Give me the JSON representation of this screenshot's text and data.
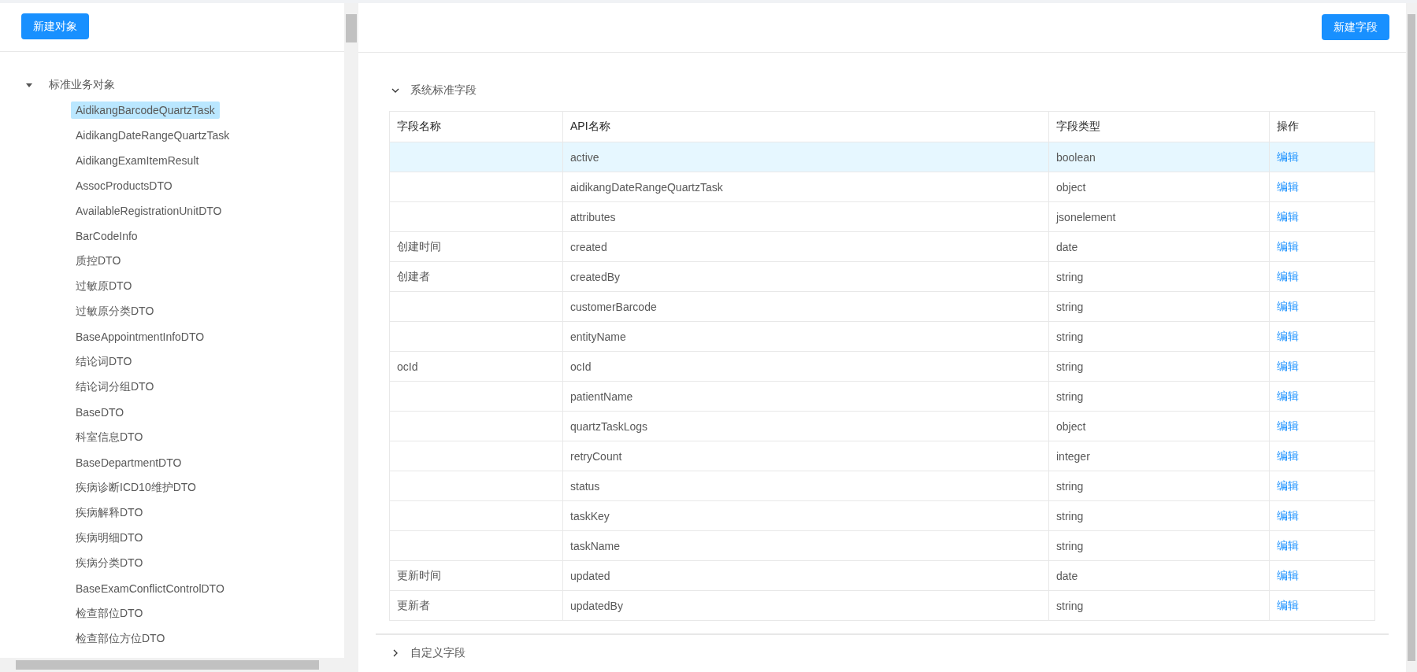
{
  "left_panel": {
    "new_object_button": "新建对象",
    "tree": {
      "label": "标准业务对象",
      "expanded": true,
      "children": [
        {
          "label": "AidikangBarcodeQuartzTask",
          "selected": true
        },
        {
          "label": "AidikangDateRangeQuartzTask",
          "selected": false
        },
        {
          "label": "AidikangExamItemResult",
          "selected": false
        },
        {
          "label": "AssocProductsDTO",
          "selected": false
        },
        {
          "label": "AvailableRegistrationUnitDTO",
          "selected": false
        },
        {
          "label": "BarCodeInfo",
          "selected": false
        },
        {
          "label": "质控DTO",
          "selected": false
        },
        {
          "label": "过敏原DTO",
          "selected": false
        },
        {
          "label": "过敏原分类DTO",
          "selected": false
        },
        {
          "label": "BaseAppointmentInfoDTO",
          "selected": false
        },
        {
          "label": "结论词DTO",
          "selected": false
        },
        {
          "label": "结论词分组DTO",
          "selected": false
        },
        {
          "label": "BaseDTO",
          "selected": false
        },
        {
          "label": "科室信息DTO",
          "selected": false
        },
        {
          "label": "BaseDepartmentDTO",
          "selected": false
        },
        {
          "label": "疾病诊断ICD10维护DTO",
          "selected": false
        },
        {
          "label": "疾病解释DTO",
          "selected": false
        },
        {
          "label": "疾病明细DTO",
          "selected": false
        },
        {
          "label": "疾病分类DTO",
          "selected": false
        },
        {
          "label": "BaseExamConflictControlDTO",
          "selected": false
        },
        {
          "label": "检查部位DTO",
          "selected": false
        },
        {
          "label": "检查部位方位DTO",
          "selected": false
        }
      ]
    }
  },
  "right_panel": {
    "new_field_button": "新建字段",
    "sections": [
      {
        "title": "系统标准字段",
        "expanded": true,
        "table": {
          "columns": [
            "字段名称",
            "API名称",
            "字段类型",
            "操作"
          ],
          "rows": [
            {
              "selected": true,
              "api_name": "active",
              "field_type": "boolean",
              "action": "编辑"
            },
            {
              "selected": false,
              "api_name": "aidikangDateRangeQuartzTask",
              "field_type": "object",
              "action": "编辑"
            },
            {
              "selected": false,
              "api_name": "attributes",
              "field_type": "jsonelement",
              "action": "编辑"
            },
            {
              "selected": false,
              "field_name": "创建时间",
              "api_name": "created",
              "field_type": "date",
              "action": "编辑"
            },
            {
              "selected": false,
              "field_name": "创建者",
              "api_name": "createdBy",
              "field_type": "string",
              "action": "编辑"
            },
            {
              "selected": false,
              "api_name": "customerBarcode",
              "field_type": "string",
              "action": "编辑"
            },
            {
              "selected": false,
              "api_name": "entityName",
              "field_type": "string",
              "action": "编辑"
            },
            {
              "selected": false,
              "field_name": "ocId",
              "api_name": "ocId",
              "field_type": "string",
              "action": "编辑"
            },
            {
              "selected": false,
              "api_name": "patientName",
              "field_type": "string",
              "action": "编辑"
            },
            {
              "selected": false,
              "api_name": "quartzTaskLogs",
              "field_type": "object",
              "action": "编辑"
            },
            {
              "selected": false,
              "api_name": "retryCount",
              "field_type": "integer",
              "action": "编辑"
            },
            {
              "selected": false,
              "api_name": "status",
              "field_type": "string",
              "action": "编辑"
            },
            {
              "selected": false,
              "api_name": "taskKey",
              "field_type": "string",
              "action": "编辑"
            },
            {
              "selected": false,
              "api_name": "taskName",
              "field_type": "string",
              "action": "编辑"
            },
            {
              "selected": false,
              "field_name": "更新时间",
              "api_name": "updated",
              "field_type": "date",
              "action": "编辑"
            },
            {
              "selected": false,
              "field_name": "更新者",
              "api_name": "updatedBy",
              "field_type": "string",
              "action": "编辑"
            }
          ]
        }
      },
      {
        "title": "自定义字段",
        "expanded": false
      }
    ]
  }
}
